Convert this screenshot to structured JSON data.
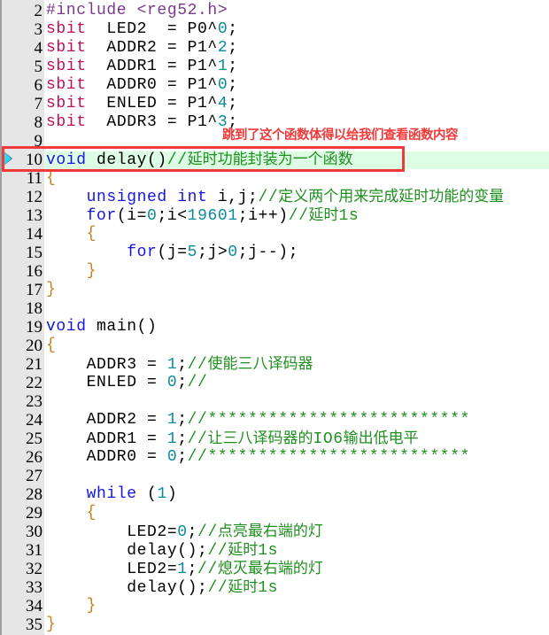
{
  "editor": {
    "language": "c",
    "current_line": 10,
    "lines": [
      {
        "n": "2",
        "tokens": [
          [
            "pre",
            "#include <reg52.h>"
          ]
        ]
      },
      {
        "n": "3",
        "tokens": [
          [
            "sbit",
            "sbit"
          ],
          [
            "",
            "  LED2  = P0^"
          ],
          [
            "num",
            "0"
          ],
          [
            "",
            ";"
          ]
        ]
      },
      {
        "n": "4",
        "tokens": [
          [
            "sbit",
            "sbit"
          ],
          [
            "",
            "  ADDR2 = P1^"
          ],
          [
            "num",
            "2"
          ],
          [
            "",
            ";"
          ]
        ]
      },
      {
        "n": "5",
        "tokens": [
          [
            "sbit",
            "sbit"
          ],
          [
            "",
            "  ADDR1 = P1^"
          ],
          [
            "num",
            "1"
          ],
          [
            "",
            ";"
          ]
        ]
      },
      {
        "n": "6",
        "tokens": [
          [
            "sbit",
            "sbit"
          ],
          [
            "",
            "  ADDR0 = P1^"
          ],
          [
            "num",
            "0"
          ],
          [
            "",
            ";"
          ]
        ]
      },
      {
        "n": "7",
        "tokens": [
          [
            "sbit",
            "sbit"
          ],
          [
            "",
            "  ENLED = P1^"
          ],
          [
            "num",
            "4"
          ],
          [
            "",
            ";"
          ]
        ]
      },
      {
        "n": "8",
        "tokens": [
          [
            "sbit",
            "sbit"
          ],
          [
            "",
            "  ADDR3 = P1^"
          ],
          [
            "num",
            "3"
          ],
          [
            "",
            ";"
          ]
        ]
      },
      {
        "n": "9",
        "tokens": []
      },
      {
        "n": "10",
        "tokens": [
          [
            "kw",
            "void"
          ],
          [
            "",
            " delay()"
          ],
          [
            "cm",
            "//"
          ],
          [
            "cmcjk",
            "延时功能封装为一个函数"
          ]
        ]
      },
      {
        "n": "11",
        "tokens": [
          [
            "br",
            "{"
          ]
        ]
      },
      {
        "n": "12",
        "tokens": [
          [
            "",
            "    "
          ],
          [
            "kw",
            "unsigned int"
          ],
          [
            "",
            " i,j;"
          ],
          [
            "cm",
            "//"
          ],
          [
            "cmcjk",
            "定义两个用来完成延时功能的变量"
          ]
        ]
      },
      {
        "n": "13",
        "tokens": [
          [
            "",
            "    "
          ],
          [
            "kw",
            "for"
          ],
          [
            "",
            "(i="
          ],
          [
            "num",
            "0"
          ],
          [
            "",
            ";i<"
          ],
          [
            "num",
            "19601"
          ],
          [
            "",
            ";i++)"
          ],
          [
            "cm",
            "//"
          ],
          [
            "cmcjk",
            "延时"
          ],
          [
            "cm",
            "1s"
          ]
        ]
      },
      {
        "n": "14",
        "tokens": [
          [
            "",
            "    "
          ],
          [
            "br",
            "{"
          ]
        ]
      },
      {
        "n": "15",
        "tokens": [
          [
            "",
            "        "
          ],
          [
            "kw",
            "for"
          ],
          [
            "",
            "(j="
          ],
          [
            "num",
            "5"
          ],
          [
            "",
            ";j>"
          ],
          [
            "num",
            "0"
          ],
          [
            "",
            ";j--);"
          ]
        ]
      },
      {
        "n": "16",
        "tokens": [
          [
            "",
            "    "
          ],
          [
            "br",
            "}"
          ]
        ]
      },
      {
        "n": "17",
        "tokens": [
          [
            "br",
            "}"
          ]
        ]
      },
      {
        "n": "18",
        "tokens": []
      },
      {
        "n": "19",
        "tokens": [
          [
            "kw",
            "void"
          ],
          [
            "",
            " main()"
          ]
        ]
      },
      {
        "n": "20",
        "tokens": [
          [
            "br",
            "{"
          ]
        ]
      },
      {
        "n": "21",
        "tokens": [
          [
            "",
            "    ADDR3 = "
          ],
          [
            "num",
            "1"
          ],
          [
            "",
            ";"
          ],
          [
            "cm",
            "//"
          ],
          [
            "cmcjk",
            "使能三八译码器"
          ]
        ]
      },
      {
        "n": "22",
        "tokens": [
          [
            "",
            "    ENLED = "
          ],
          [
            "num",
            "0"
          ],
          [
            "",
            ";"
          ],
          [
            "cm",
            "//"
          ]
        ]
      },
      {
        "n": "23",
        "tokens": []
      },
      {
        "n": "24",
        "tokens": [
          [
            "",
            "    ADDR2 = "
          ],
          [
            "num",
            "1"
          ],
          [
            "",
            ";"
          ],
          [
            "cm",
            "//**************************"
          ]
        ]
      },
      {
        "n": "25",
        "tokens": [
          [
            "",
            "    ADDR1 = "
          ],
          [
            "num",
            "1"
          ],
          [
            "",
            ";"
          ],
          [
            "cm",
            "//"
          ],
          [
            "cmcjk",
            "让三八译码器的"
          ],
          [
            "cm",
            "IO6"
          ],
          [
            "cmcjk",
            "输出低电平"
          ]
        ]
      },
      {
        "n": "26",
        "tokens": [
          [
            "",
            "    ADDR0 = "
          ],
          [
            "num",
            "0"
          ],
          [
            "",
            ";"
          ],
          [
            "cm",
            "//**************************"
          ]
        ]
      },
      {
        "n": "27",
        "tokens": []
      },
      {
        "n": "28",
        "tokens": [
          [
            "",
            "    "
          ],
          [
            "kw",
            "while"
          ],
          [
            "",
            " ("
          ],
          [
            "num",
            "1"
          ],
          [
            "",
            ")"
          ]
        ]
      },
      {
        "n": "29",
        "tokens": [
          [
            "",
            "    "
          ],
          [
            "br",
            "{"
          ]
        ]
      },
      {
        "n": "30",
        "tokens": [
          [
            "",
            "        LED2="
          ],
          [
            "num",
            "0"
          ],
          [
            "",
            ";"
          ],
          [
            "cm",
            "//"
          ],
          [
            "cmcjk",
            "点亮最右端的灯"
          ]
        ]
      },
      {
        "n": "31",
        "tokens": [
          [
            "",
            "        delay();"
          ],
          [
            "cm",
            "//"
          ],
          [
            "cmcjk",
            "延时"
          ],
          [
            "cm",
            "1s"
          ]
        ]
      },
      {
        "n": "32",
        "tokens": [
          [
            "",
            "        LED2="
          ],
          [
            "num",
            "1"
          ],
          [
            "",
            ";"
          ],
          [
            "cm",
            "//"
          ],
          [
            "cmcjk",
            "熄灭最右端的灯"
          ]
        ]
      },
      {
        "n": "33",
        "tokens": [
          [
            "",
            "        delay();"
          ],
          [
            "cm",
            "//"
          ],
          [
            "cmcjk",
            "延时"
          ],
          [
            "cm",
            "1s"
          ]
        ]
      },
      {
        "n": "34",
        "tokens": [
          [
            "",
            "    "
          ],
          [
            "br",
            "}"
          ]
        ]
      },
      {
        "n": "35",
        "tokens": [
          [
            "br",
            "}"
          ]
        ]
      }
    ]
  },
  "annotation": {
    "text": "跳到了这个函数体得以给我们查看函数内容",
    "color": "#f03a3a"
  },
  "marker": {
    "icon": "current-line-arrow-icon",
    "color": "#2cd5f0"
  },
  "colors": {
    "keyword": "#1515e0",
    "sbit": "#c0105a",
    "number": "#0a8a9a",
    "comment": "#1f8f1f",
    "preprocessor": "#7a3a8a",
    "brace": "#c8821e",
    "current_line_bg": "#dcfce4",
    "highlight_box": "#f03a3a"
  }
}
